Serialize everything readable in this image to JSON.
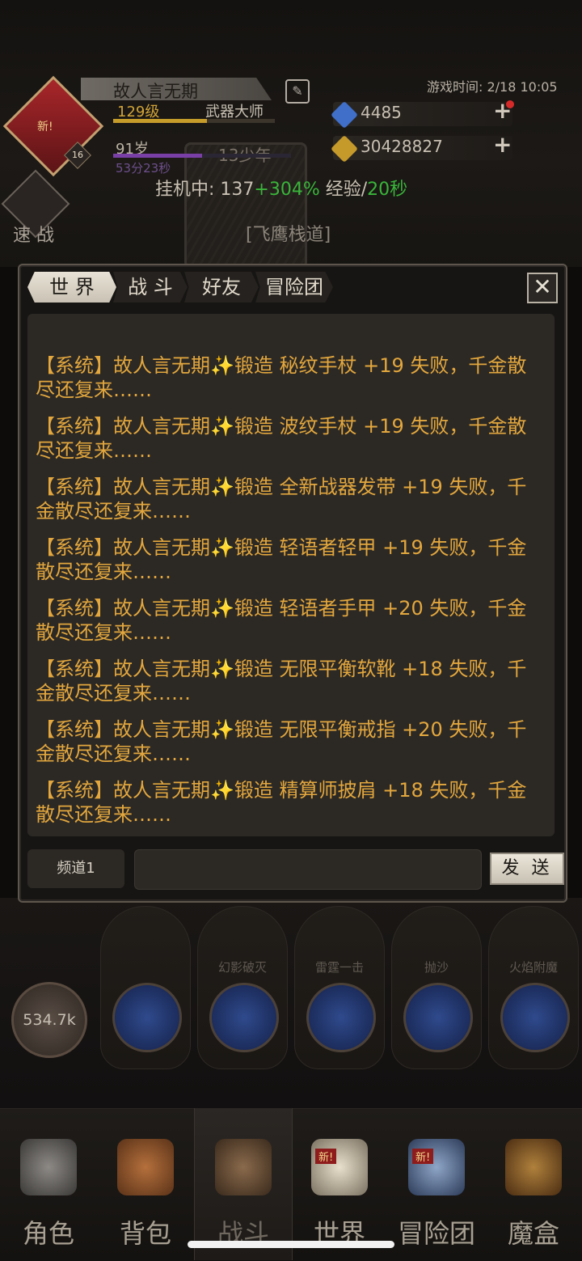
{
  "player": {
    "name": "故人言无期",
    "new_badge": "新!",
    "avatar_level": "16",
    "level": "129级",
    "title": "武器大师",
    "age": "91岁",
    "age_stage": "13少年",
    "timer": "53分23秒",
    "game_time": "游戏时间: 2/18 10:05",
    "level_progress": 0.58,
    "age_progress": 0.5
  },
  "resources": {
    "gems": "4485",
    "gold": "30428827",
    "plus": "+"
  },
  "idle": {
    "prefix": "挂机中: 137",
    "bonus": "+304%",
    "middle": " 经验/",
    "rate": "20秒"
  },
  "location": "[飞鹰栈道]",
  "speed_battle": "速 战",
  "chat": {
    "tabs": [
      "世 界",
      "战 斗",
      "好友",
      "冒险团"
    ],
    "close": "✕",
    "channel": "频道1",
    "input_value": "",
    "send": "发 送",
    "messages": [
      "【系统】故人言无期✨锻造 秘纹手杖 +19 失败，千金散尽还复来……",
      "【系统】故人言无期✨锻造 波纹手杖 +19 失败，千金散尽还复来……",
      "【系统】故人言无期✨锻造 全新战器发带 +19 失败，千金散尽还复来……",
      "【系统】故人言无期✨锻造 轻语者轻甲 +19 失败，千金散尽还复来……",
      "【系统】故人言无期✨锻造 轻语者手甲 +20 失败，千金散尽还复来……",
      "【系统】故人言无期✨锻造 无限平衡软靴 +18 失败，千金散尽还复来……",
      "【系统】故人言无期✨锻造 无限平衡戒指 +20 失败，千金散尽还复来……",
      "【系统】故人言无期✨锻造 精算师披肩 +18 失败，千金散尽还复来……"
    ]
  },
  "battle": {
    "hp": "534.7k",
    "skills": [
      "幻影破灭",
      "雷霆一击",
      "抛沙",
      "火焰附魔"
    ]
  },
  "nav": {
    "items": [
      "角色",
      "背包",
      "战斗",
      "世界",
      "冒险团",
      "魔盒"
    ],
    "new_badge": "新!"
  },
  "colors": {
    "message_text": "#e3a73d",
    "idle_bonus": "#39b53a",
    "level_text": "#d2a437"
  }
}
